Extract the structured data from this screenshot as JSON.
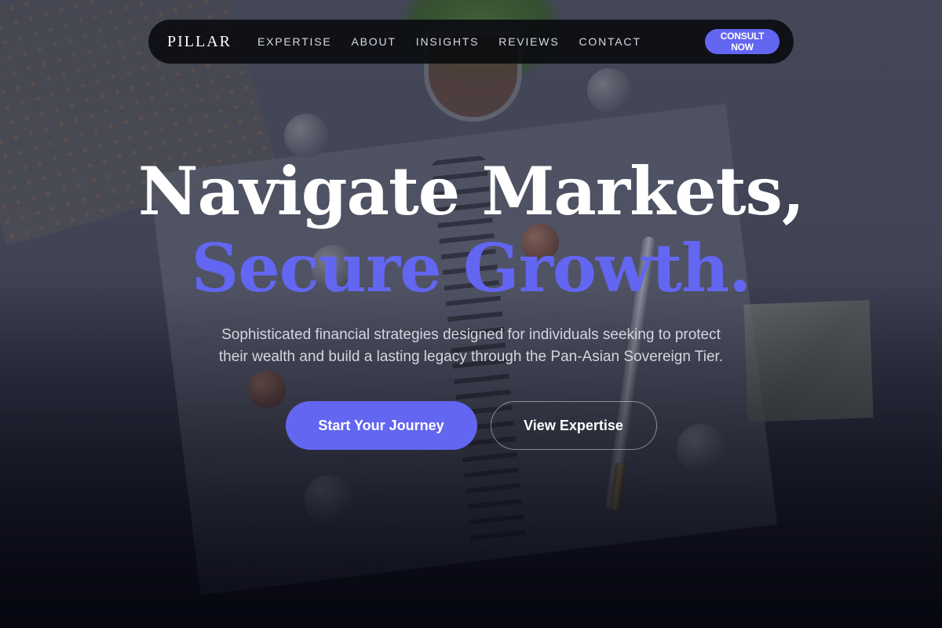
{
  "nav": {
    "brand": "PILLAR",
    "links": [
      {
        "label": "EXPERTISE"
      },
      {
        "label": "ABOUT"
      },
      {
        "label": "INSIGHTS"
      },
      {
        "label": "REVIEWS"
      },
      {
        "label": "CONTACT"
      }
    ],
    "cta_label": "CONSULT NOW"
  },
  "hero": {
    "headline_line1": "Navigate Markets,",
    "headline_line2": "Secure Growth.",
    "subtext": "Sophisticated financial strategies designed for individuals seeking to protect their wealth and build a lasting legacy through the Pan-Asian Sovereign Tier.",
    "primary_button": "Start Your Journey",
    "secondary_button": "View Expertise"
  },
  "colors": {
    "accent": "#6366f1",
    "nav_background": "#0a0b10",
    "text_primary": "#ffffff",
    "text_muted": "#d4d6e0"
  }
}
